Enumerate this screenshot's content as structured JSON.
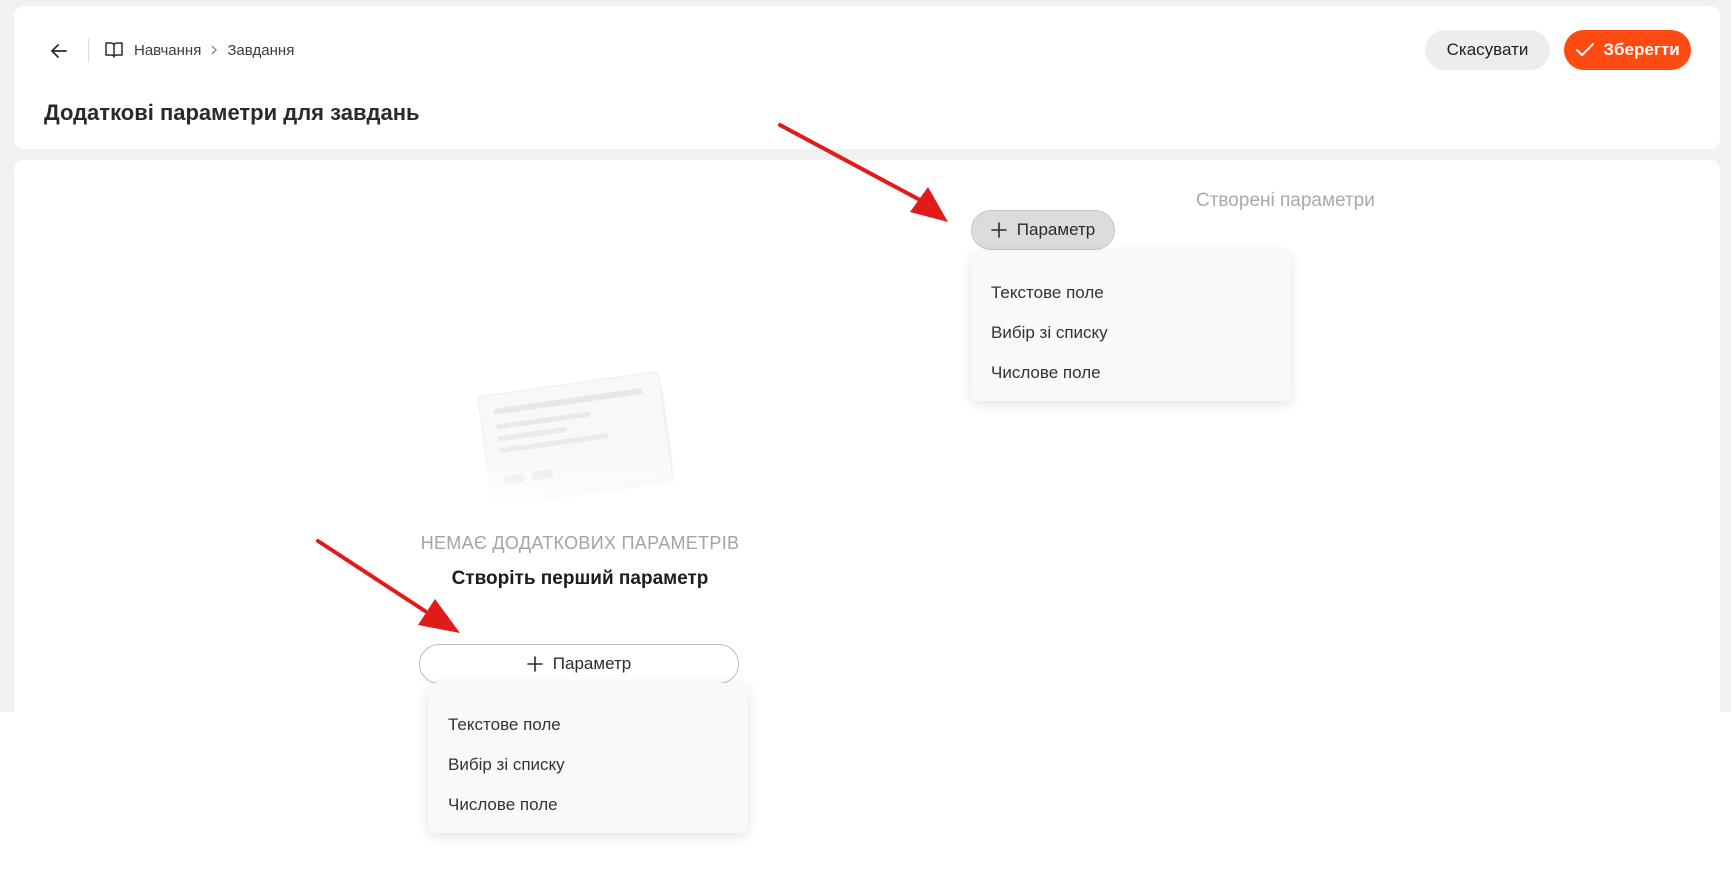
{
  "header": {
    "breadcrumb": [
      "Навчання",
      "Завдання"
    ],
    "title": "Додаткові параметри для завдань",
    "cancel_label": "Скасувати",
    "save_label": "Зберегти"
  },
  "created_section": {
    "label": "Створені параметри"
  },
  "param_button_label": "Параметр",
  "menu_items": [
    "Текстове поле",
    "Вибір зі списку",
    "Числове поле"
  ],
  "empty_state": {
    "title": "НЕМАЄ ДОДАТКОВИХ ПАРАМЕТРІВ",
    "subtitle": "Створіть перший параметр"
  },
  "colors": {
    "accent": "#ff4a12",
    "annotation_arrow": "#e11a1a"
  },
  "icons": [
    "arrow-left-icon",
    "book-icon",
    "chevron-right-icon",
    "check-icon",
    "plus-icon"
  ]
}
